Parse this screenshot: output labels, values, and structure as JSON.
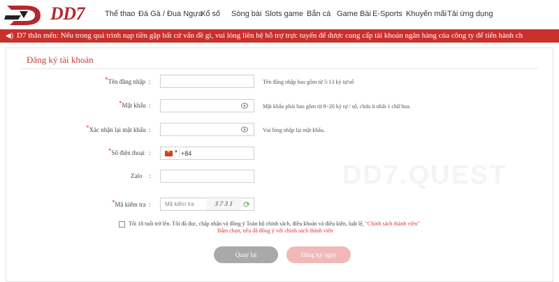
{
  "brand": {
    "name": "DD7",
    "color": "#b7282e"
  },
  "nav": {
    "items": [
      "Thể thao",
      "Đá Gà / Đua Ngựa",
      "Xổ số",
      "Sòng bài",
      "Slots game",
      "Bắn cá",
      "Game Bài",
      "E-Sports",
      "Khuyến mãi",
      "Tải ứng dụng"
    ]
  },
  "marquee": {
    "text": "D7 thân mến: Nếu trong quá trình nạp tiền gặp bất cứ vấn đề gì, vui lòng liên hệ hỗ trợ trực tuyến để được cung cấp tài khoản ngân hàng của công ty để tiến hành ch",
    "color": "#c9302c"
  },
  "form": {
    "title": "Đăng ký tài khoản",
    "fields": [
      {
        "label": "Tên đăng nhập",
        "required": true,
        "value": "",
        "hint": "Tên đăng nhập bao gồm từ 5-13 ký tự/số"
      },
      {
        "label": "Mật khẩu",
        "required": true,
        "value": "",
        "hint": "Mật khẩu phải bao gồm từ 8~20 ký tự / số, chứa ít nhất 1 chữ hoa."
      },
      {
        "label": "Xác nhận lại mật khẩu",
        "required": true,
        "value": "",
        "hint": "Vui lòng nhập lại mật khẩu."
      },
      {
        "label": "Số điện thoại",
        "required": true,
        "value": "+84",
        "hint": ""
      },
      {
        "label": "Zalo",
        "required": false,
        "value": "",
        "hint": ""
      },
      {
        "label": "Mã kiểm tra",
        "required": true,
        "placeholder": "Mã kiểm tra",
        "captcha": "3731",
        "hint": ""
      }
    ],
    "agree_text": "Tôi 18 tuổi trở lên. Tôi đã đọc, chấp nhận và đồng ý Toàn bộ chính sách, điều khoản và điều kiện, luật lệ,",
    "agree_link": "\"Chính sách thành viên\"",
    "warning": "Bấm chọn, nếu đã đồng ý với chính sách thành viên",
    "back_label": "Quay lại",
    "submit_label": "Đăng ký ngay"
  },
  "watermark": "DD7.QUEST"
}
